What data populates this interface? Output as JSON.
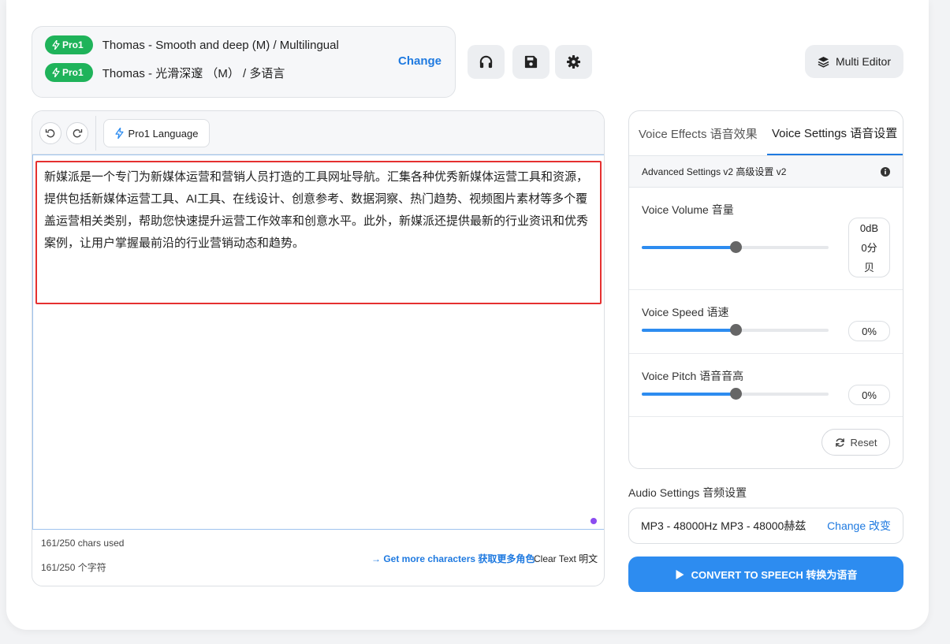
{
  "voice": {
    "badge": "Pro1",
    "primary": "Thomas - Smooth and deep (M) / Multilingual",
    "secondary": "Thomas - 光滑深邃 （M） / 多语言",
    "change_label": "Change"
  },
  "toolbar_icons": [
    "headphones-icon",
    "save-icon",
    "gear-icon"
  ],
  "multi_editor_label": "Multi Editor",
  "editor": {
    "language_button": "Pro1 Language",
    "text": "新媒派是一个专门为新媒体运营和营销人员打造的工具网址导航。汇集各种优秀新媒体运营工具和资源，提供包括新媒体运营工具、AI工具、在线设计、创意参考、数据洞察、热门趋势、视频图片素材等多个覆盖运营相关类别，帮助您快速提升运营工作效率和创意水平。此外，新媒派还提供最新的行业资讯和优秀案例，让用户掌握最前沿的行业营销动态和趋势。",
    "chars_used_en": "161/250 chars used",
    "chars_used_zh": "161/250 个字符",
    "more_chars": "→ Get more characters 获取更多角色",
    "clear_text": "Clear Text 明文"
  },
  "settings": {
    "tab_effects": "Voice Effects 语音效果",
    "tab_settings": "Voice Settings 语音设置",
    "advanced": "Advanced Settings v2 高级设置 v2",
    "volume": {
      "label": "Voice Volume 音量",
      "value_line1": "0dB",
      "value_line2": "0分",
      "value_line3": "贝",
      "level": 0.5
    },
    "speed": {
      "label": "Voice Speed 语速",
      "value": "0%",
      "level": 0.5
    },
    "pitch": {
      "label": "Voice Pitch 语音音高",
      "value": "0%",
      "level": 0.5
    },
    "reset": "Reset"
  },
  "audio": {
    "title": "Audio Settings 音频设置",
    "format": "MP3 - 48000Hz MP3 - 48000赫兹",
    "change": "Change 改变"
  },
  "convert_label": "CONVERT TO SPEECH 转换为语音",
  "colors": {
    "accent": "#2d8cf0",
    "pro_badge": "#1fb35a",
    "highlight": "#e53030"
  }
}
